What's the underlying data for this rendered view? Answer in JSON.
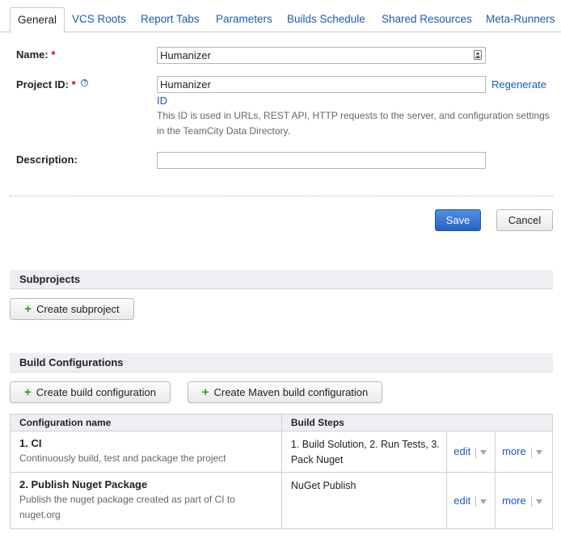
{
  "tabs": [
    {
      "label": "General",
      "active": true
    },
    {
      "label": "VCS Roots"
    },
    {
      "label": "Report Tabs"
    },
    {
      "label": "Parameters"
    },
    {
      "label": "Builds Schedule"
    },
    {
      "label": "Shared Resources"
    },
    {
      "label": "Meta-Runners"
    }
  ],
  "form": {
    "name_label": "Name:",
    "name_value": "Humanizer",
    "project_id_label": "Project ID:",
    "project_id_value": "Humanizer",
    "regenerate_line1": "Regenerate",
    "regenerate_line2": "ID",
    "project_id_note": "This ID is used in URLs, REST API, HTTP requests to the server, and configuration settings in the TeamCity Data Directory.",
    "description_label": "Description:",
    "description_value": "",
    "required_mark": "*",
    "help_glyph": "?"
  },
  "actions": {
    "save_label": "Save",
    "cancel_label": "Cancel"
  },
  "subprojects": {
    "title": "Subprojects",
    "create_label": "Create subproject"
  },
  "build_configurations": {
    "title": "Build Configurations",
    "create_label": "Create build configuration",
    "create_maven_label": "Create Maven build configuration",
    "columns": [
      "Configuration name",
      "Build Steps"
    ],
    "rows": [
      {
        "name": "1. CI",
        "description": "Continuously build, test and package the project",
        "steps": "1. Build Solution, 2. Run Tests, 3. Pack Nuget",
        "edit": "edit",
        "more": "more"
      },
      {
        "name": "2. Publish Nuget Package",
        "description": "Publish the nuget package created as part of CI to nuget.org",
        "steps": "NuGet Publish",
        "edit": "edit",
        "more": "more"
      }
    ]
  },
  "icons": {
    "plus": "+",
    "contact_card": "contact-card-icon",
    "dropdown": "caret-down-icon"
  },
  "colors": {
    "link": "#1a5bb8",
    "primary_button": "#2564c3",
    "required": "#d20000",
    "add_icon": "#2a9d2a"
  }
}
